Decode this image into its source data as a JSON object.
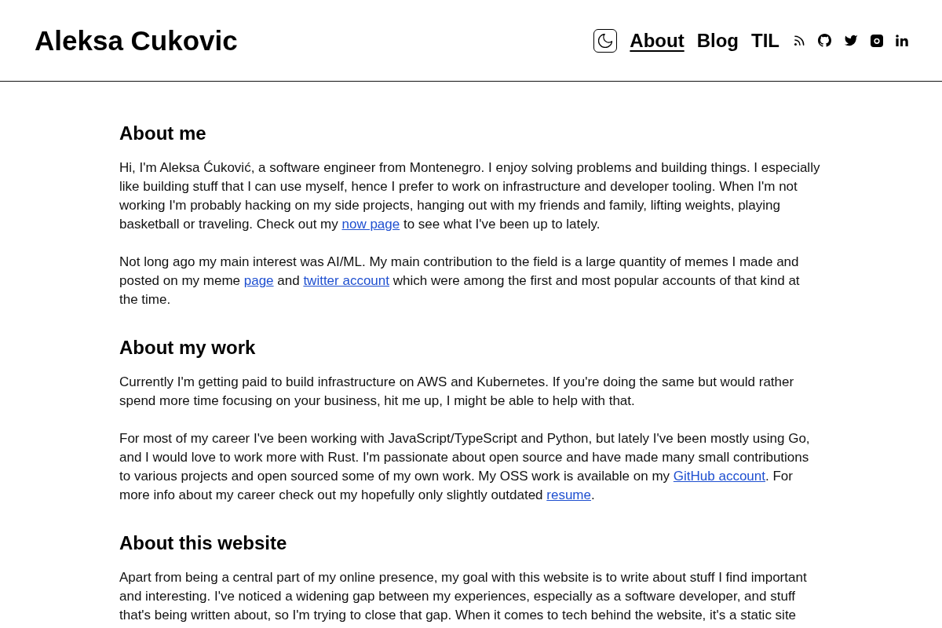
{
  "header": {
    "site_title": "Aleksa Cukovic",
    "nav_links": [
      {
        "label": "About",
        "selected": true
      },
      {
        "label": "Blog",
        "selected": false
      },
      {
        "label": "TIL",
        "selected": false
      }
    ],
    "social_links": [
      {
        "kind": "rss"
      },
      {
        "kind": "github"
      },
      {
        "kind": "twitter"
      },
      {
        "kind": "instagram"
      },
      {
        "kind": "linkedin"
      }
    ]
  },
  "sections": [
    {
      "heading": "About me",
      "paragraphs": [
        [
          {
            "kind": "text",
            "text": "Hi, I'm Aleksa Ćuković, a software engineer from Montenegro. I enjoy solving problems and building things. I especially like building stuff that I can use myself, hence I prefer to work on infrastructure and developer tooling. When I'm not working I'm probably hacking on my side projects, hanging out with my friends and family, lifting weights, playing basketball or traveling. Check out my "
          },
          {
            "kind": "link",
            "text": "now page"
          },
          {
            "kind": "text",
            "text": " to see what I've been up to lately."
          }
        ],
        [
          {
            "kind": "text",
            "text": "Not long ago my main interest was AI/ML. My main contribution to the field is a large quantity of memes I made and posted on my meme "
          },
          {
            "kind": "link",
            "text": "page"
          },
          {
            "kind": "text",
            "text": " and "
          },
          {
            "kind": "link",
            "text": "twitter account"
          },
          {
            "kind": "text",
            "text": " which were among the first and most popular accounts of that kind at the time."
          }
        ]
      ]
    },
    {
      "heading": "About my work",
      "paragraphs": [
        [
          {
            "kind": "text",
            "text": "Currently I'm getting paid to build infrastructure on AWS and Kubernetes. If you're doing the same but would rather spend more time focusing on your business, hit me up, I might be able to help with that."
          }
        ],
        [
          {
            "kind": "text",
            "text": "For most of my career I've been working with JavaScript/TypeScript and Python, but lately I've been mostly using Go, and I would love to work more with Rust. I'm passionate about open source and have made many small contributions to various projects and open sourced some of my own work. My OSS work is available on my "
          },
          {
            "kind": "link",
            "text": "GitHub account"
          },
          {
            "kind": "text",
            "text": ". For more info about my career check out my hopefully only slightly outdated "
          },
          {
            "kind": "link",
            "text": "resume"
          },
          {
            "kind": "text",
            "text": "."
          }
        ]
      ]
    },
    {
      "heading": "About this website",
      "paragraphs": [
        [
          {
            "kind": "text",
            "text": "Apart from being a central part of my online presence, my goal with this website is to write about stuff I find important and interesting. I've noticed a widening gap between my experiences, especially as a software developer, and stuff that's being written about, so I'm trying to close that gap. When it comes to tech behind the website, it's a static site"
          }
        ]
      ]
    }
  ]
}
